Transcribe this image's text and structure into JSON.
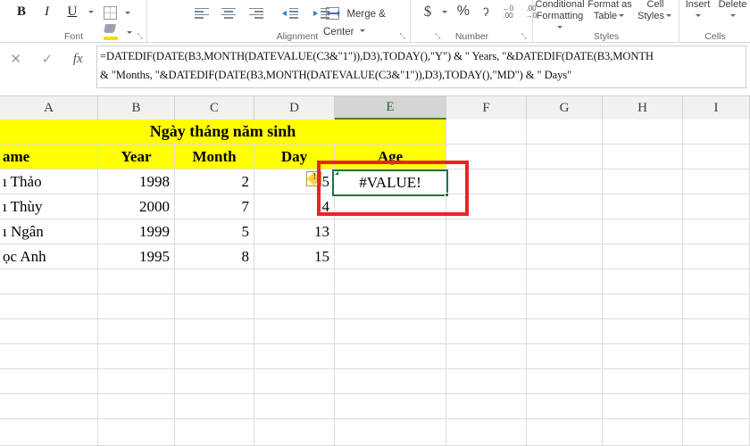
{
  "ribbon": {
    "font_group": {
      "caption": "Font",
      "bold": "B",
      "italic": "I",
      "underline": "U",
      "borders_icon": "borders-icon",
      "fill_icon": "fill-color-icon",
      "fontcolor_icon": "font-color-icon",
      "launcher": "⤡"
    },
    "alignment_group": {
      "caption": "Alignment",
      "align_left_icon": "align-left-icon",
      "align_center_icon": "align-center-icon",
      "align_right_icon": "align-right-icon",
      "decrease_indent_icon": "decrease-indent-icon",
      "increase_indent_icon": "increase-indent-icon",
      "merge_label": "Merge & Center",
      "launcher": "⤡"
    },
    "number_group": {
      "caption": "Number",
      "currency": "$",
      "percent": "%",
      "comma": "ʔ",
      "increase_decimal": "increase-decimal-icon",
      "decrease_decimal": "decrease-decimal-icon",
      "increase_decimal_top": ".00",
      "increase_decimal_bottom": "→0",
      "decrease_decimal_top": "←0",
      "decrease_decimal_bottom": ".00",
      "launcher": "⤡"
    },
    "styles_group": {
      "caption": "Styles",
      "conditional_line1": "Conditional",
      "conditional_line2": "Formatting",
      "format_table_line1": "Format as",
      "format_table_line2": "Table",
      "cell_styles_line1": "Cell",
      "cell_styles_line2": "Styles"
    },
    "cells_group": {
      "caption": "Cells",
      "insert": "Insert",
      "delete": "Delete"
    }
  },
  "formula_bar": {
    "cancel_icon": "✕",
    "confirm_icon": "✓",
    "function_icon": "fx",
    "formula_line1": "=DATEDIF(DATE(B3,MONTH(DATEVALUE(C3&\"1\")),D3),TODAY(),\"Y\") & \" Years, \"&DATEDIF(DATE(B3,MONTH",
    "formula_line2": "& \"Months, \"&DATEDIF(DATE(B3,MONTH(DATEVALUE(C3&\"1\")),D3),TODAY(),\"MD\") & \" Days\""
  },
  "grid": {
    "columns": [
      "A",
      "B",
      "C",
      "D",
      "E",
      "F",
      "G",
      "H",
      "I"
    ],
    "selected_column": "E",
    "title_banner": "Ngày tháng năm sinh",
    "headers": {
      "name": "ame",
      "year": "Year",
      "month": "Month",
      "day": "Day",
      "age": "Age"
    },
    "rows": [
      {
        "name": "ı Thảo",
        "year": "1998",
        "month": "2",
        "day": "5",
        "age": ""
      },
      {
        "name": "ı Thùy",
        "year": "2000",
        "month": "7",
        "day": "4",
        "age": ""
      },
      {
        "name": "ı Ngân",
        "year": "1999",
        "month": "5",
        "day": "13",
        "age": ""
      },
      {
        "name": "ọc Anh",
        "year": "1995",
        "month": "8",
        "day": "15",
        "age": ""
      }
    ],
    "selected_cell_value": "#VALUE!",
    "error_indicator_icon": "error-warning-icon",
    "error_indicator_glyph": "!",
    "annotation_color": "#ee2222",
    "highlight_color": "#ffff00",
    "selection_color": "#207245"
  }
}
